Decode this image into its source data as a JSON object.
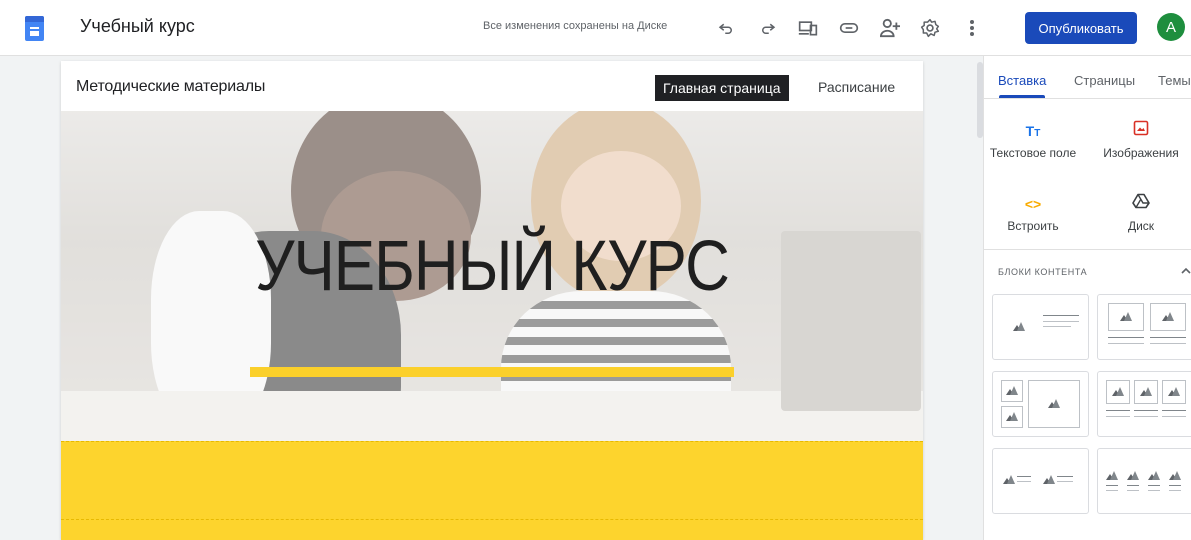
{
  "app": {
    "title": "Учебный курс",
    "save_status": "Все изменения сохранены на Диске",
    "publish_label": "Опубликовать",
    "avatar_letter": "A"
  },
  "toolbar": {
    "icons": [
      "undo-icon",
      "redo-icon",
      "preview-icon",
      "link-icon",
      "share-icon",
      "settings-icon",
      "more-icon"
    ]
  },
  "site": {
    "name": "Методические материалы",
    "nav": [
      "Главная страница",
      "Расписание"
    ],
    "hero_title": "УЧЕБНЫЙ КУРС"
  },
  "panel": {
    "tabs": [
      "Вставка",
      "Страницы",
      "Темы"
    ],
    "insert_items": [
      {
        "label": "Текстовое поле",
        "icon": "text-box-icon"
      },
      {
        "label": "Изображения",
        "icon": "image-icon"
      },
      {
        "label": "Встроить",
        "icon": "embed-icon"
      },
      {
        "label": "Диск",
        "icon": "drive-icon"
      }
    ],
    "section_title": "БЛОКИ КОНТЕНТА"
  },
  "colors": {
    "accent": "#1a4aba",
    "hero_yellow": "#fdd42d",
    "avatar": "#1e8e3e"
  }
}
